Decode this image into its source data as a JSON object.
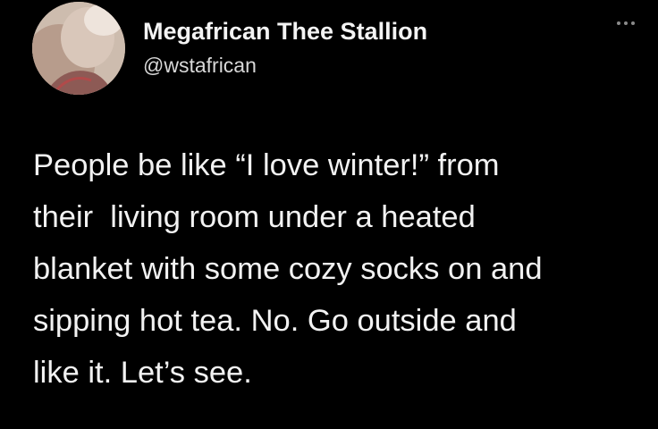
{
  "tweet": {
    "author": {
      "display_name": "Megafrican Thee Stallion",
      "handle": "@wstafrican"
    },
    "more_icon": "ellipsis-icon",
    "body_lines": [
      "People be like “I love winter!” from",
      "their  living room under a heated",
      "blanket with some cozy socks on and",
      "sipping hot tea. No. Go outside and",
      "like it. Let’s see."
    ]
  },
  "colors": {
    "background": "#000000",
    "text": "#f2f2f2",
    "secondary_text": "#d8d8d8"
  }
}
